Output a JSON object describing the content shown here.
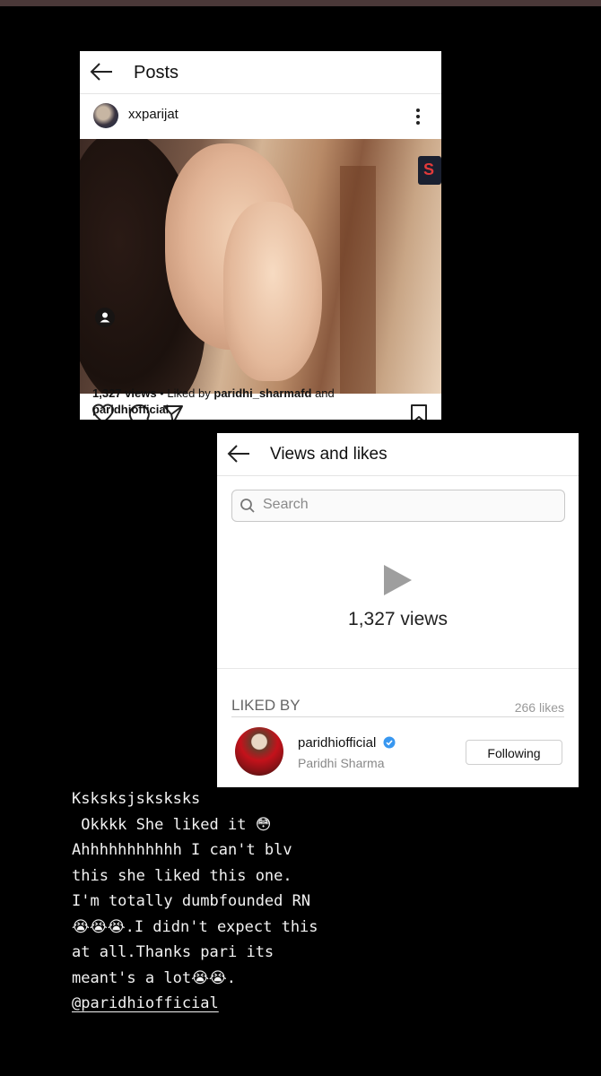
{
  "posts_card": {
    "title": "Posts",
    "username": "xxparijat",
    "views": "1,327 views",
    "liked_by_prefix": " • Liked by ",
    "liked_by_user": "paridhi_sharmafd",
    "and_text": " and",
    "liked_by_second": "paridhiofficial"
  },
  "views_card": {
    "title": "Views and likes",
    "search_placeholder": "Search",
    "views_count": "1,327 views",
    "liked_by_label": "LIKED BY",
    "likes_count": "266 likes",
    "liker_username": "paridhiofficial",
    "liker_fullname": "Paridhi Sharma",
    "follow_button": "Following"
  },
  "caption": {
    "line1": "Ksksksjsksksks",
    "line2": " Okkkk She liked it ",
    "line2_emoji": "😳",
    "line3": "Ahhhhhhhhhhh I can't blv",
    "line4": "this she liked this one.",
    "line5": "I'm totally dumbfounded RN",
    "line6_emoji": "😭😭😭",
    "line6": ".I didn't expect this",
    "line7": "at all.Thanks pari its",
    "line8": "meant's a lot",
    "line8_emoji": "😭😭",
    "line8_end": ".",
    "mention": "@paridhiofficial"
  },
  "colors": {
    "background": "#000000",
    "verified": "#3897f0"
  },
  "icons": [
    "back-arrow-icon",
    "more-options-icon",
    "heart-icon",
    "comment-icon",
    "share-icon",
    "bookmark-icon",
    "search-icon",
    "play-icon",
    "verified-badge-icon",
    "user-tag-icon"
  ]
}
